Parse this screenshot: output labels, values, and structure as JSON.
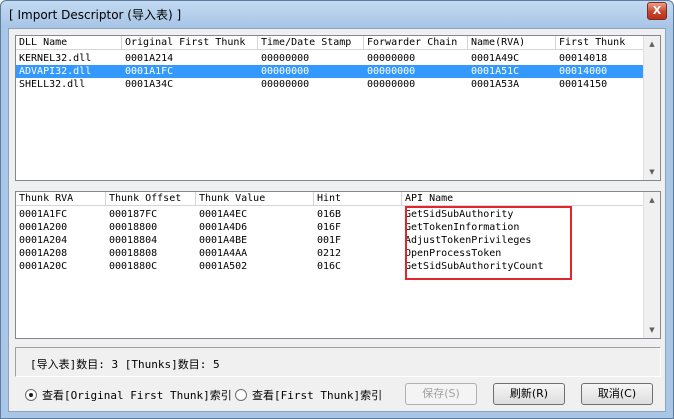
{
  "window": {
    "title": "[ Import Descriptor (导入表) ]",
    "close_glyph": "X"
  },
  "dll_table": {
    "columns": [
      "DLL Name",
      "Original First Thunk",
      "Time/Date Stamp",
      "Forwarder Chain",
      "Name(RVA)",
      "First Thunk"
    ],
    "rows": [
      [
        "KERNEL32.dll",
        "0001A214",
        "00000000",
        "00000000",
        "0001A49C",
        "00014018"
      ],
      [
        "ADVAPI32.dll",
        "0001A1FC",
        "00000000",
        "00000000",
        "0001A51C",
        "00014000"
      ],
      [
        "SHELL32.dll",
        "0001A34C",
        "00000000",
        "00000000",
        "0001A53A",
        "00014150"
      ]
    ],
    "selected_row": 1
  },
  "thunk_table": {
    "columns": [
      "Thunk RVA",
      "Thunk Offset",
      "Thunk Value",
      "Hint",
      "API Name"
    ],
    "rows": [
      [
        "0001A1FC",
        "000187FC",
        "0001A4EC",
        "016B",
        "GetSidSubAuthority"
      ],
      [
        "0001A200",
        "00018800",
        "0001A4D6",
        "016F",
        "GetTokenInformation"
      ],
      [
        "0001A204",
        "00018804",
        "0001A4BE",
        "001F",
        "AdjustTokenPrivileges"
      ],
      [
        "0001A208",
        "00018808",
        "0001A4AA",
        "0212",
        "OpenProcessToken"
      ],
      [
        "0001A20C",
        "0001880C",
        "0001A502",
        "016C",
        "GetSidSubAuthorityCount"
      ]
    ]
  },
  "status": {
    "text": "[导入表]数目: 3  [Thunks]数目: 5"
  },
  "options": {
    "radio_original": "查看[Original First Thunk]索引",
    "radio_first": "查看[First Thunk]索引",
    "selected": "original"
  },
  "buttons": {
    "save": "保存(S)",
    "refresh": "刷新(R)",
    "cancel": "取消(C)"
  },
  "colors": {
    "selection": "#3399ff",
    "highlight_box": "#e2262e"
  }
}
